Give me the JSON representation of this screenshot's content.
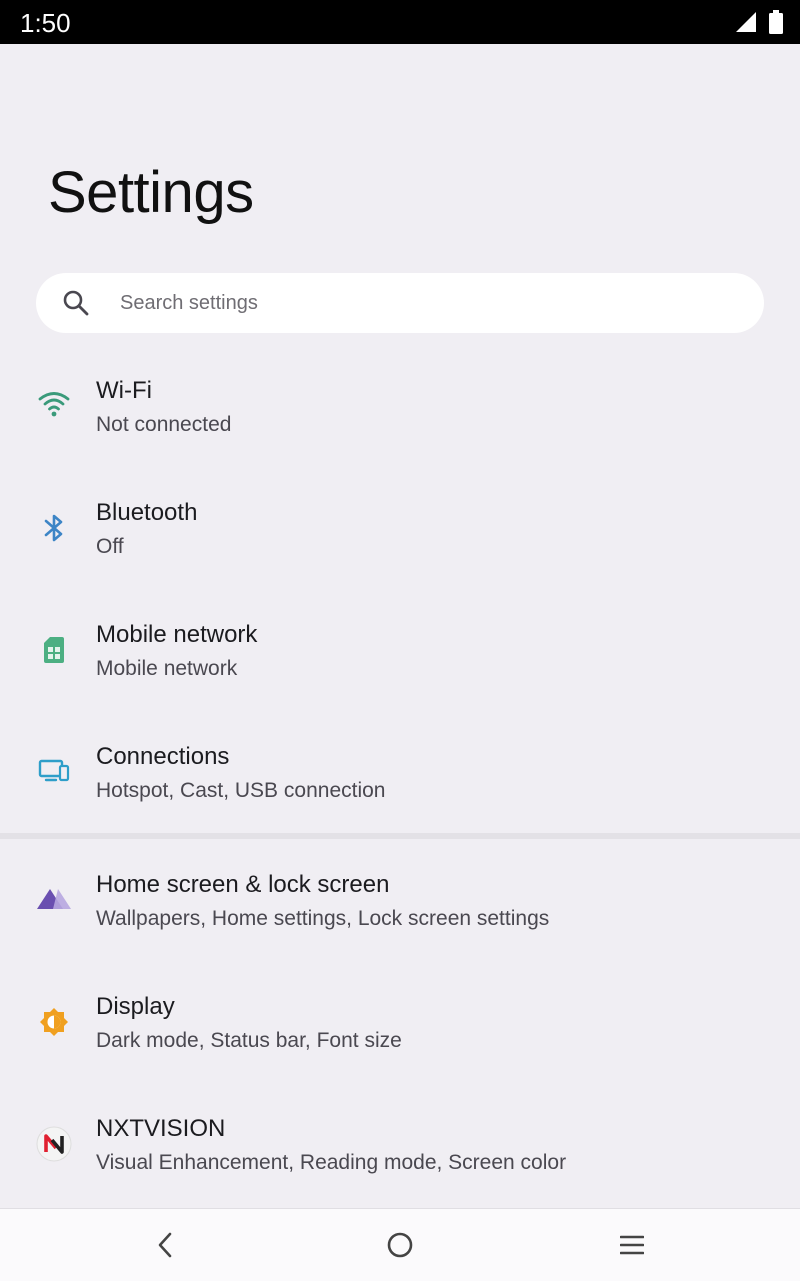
{
  "status_bar": {
    "time": "1:50",
    "icons": [
      "cellular-signal-icon",
      "battery-icon"
    ]
  },
  "header": {
    "title": "Settings"
  },
  "search": {
    "placeholder": "Search settings",
    "icon": "search-icon"
  },
  "settings": {
    "items": [
      {
        "title": "Wi-Fi",
        "subtitle": "Not connected",
        "icon": "wifi-icon",
        "color": "#3a9a7a"
      },
      {
        "title": "Bluetooth",
        "subtitle": "Off",
        "icon": "bluetooth-icon",
        "color": "#3d85c6"
      },
      {
        "title": "Mobile network",
        "subtitle": "Mobile network",
        "icon": "sim-card-icon",
        "color": "#4caf82"
      },
      {
        "title": "Connections",
        "subtitle": "Hotspot, Cast, USB connection",
        "icon": "devices-icon",
        "color": "#2e9ec9"
      },
      {
        "title": "Home screen & lock screen",
        "subtitle": "Wallpapers, Home settings, Lock screen settings",
        "icon": "home-lock-icon",
        "color": "#7b5fb8"
      },
      {
        "title": "Display",
        "subtitle": "Dark mode, Status bar, Font size",
        "icon": "brightness-icon",
        "color": "#f0a020"
      },
      {
        "title": "NXTVISION",
        "subtitle": "Visual Enhancement, Reading mode, Screen color",
        "icon": "nxtvision-icon",
        "color": "#e02030"
      }
    ]
  },
  "nav_bar": {
    "icons": [
      "back-icon",
      "home-icon",
      "menu-icon"
    ]
  },
  "colors": {
    "background": "#f0eef3",
    "status_bar": "#000000",
    "search_bg": "#ffffff",
    "title_text": "#111111",
    "subtitle_text": "#4a4850"
  }
}
